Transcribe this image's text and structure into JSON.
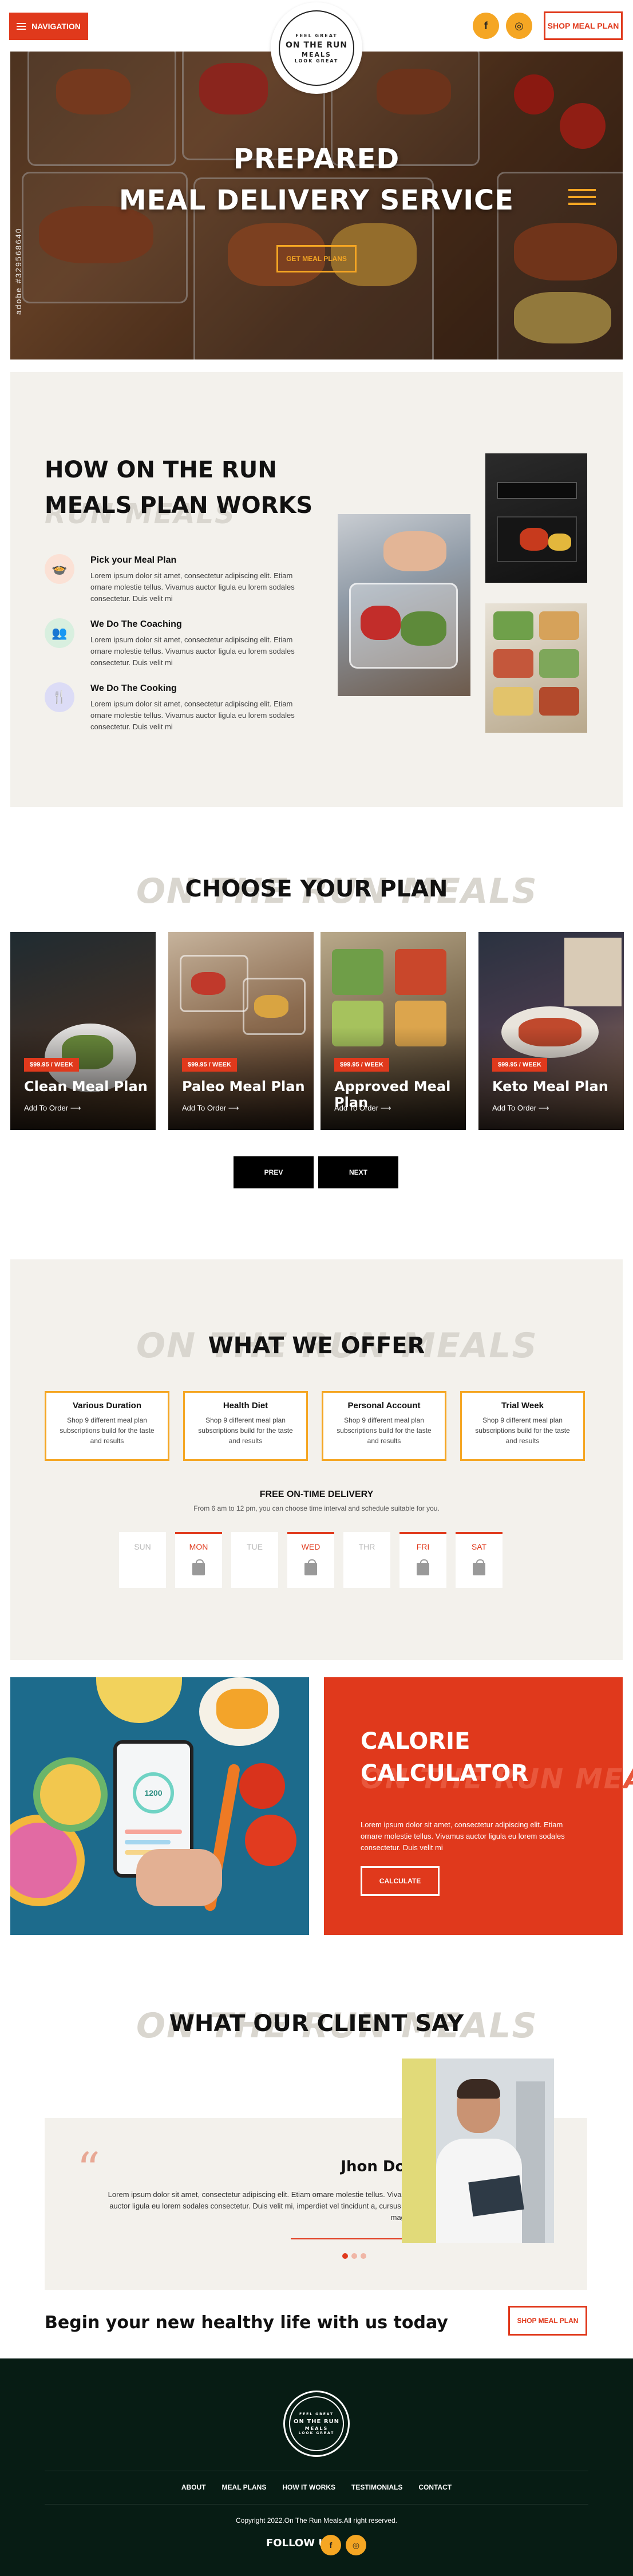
{
  "header": {
    "nav_label": "NAVIGATION",
    "logo": {
      "top": "FEEL GREAT",
      "main": "ON THE RUN",
      "sub": "MEALS",
      "bottom": "LOOK GREAT"
    },
    "social": [
      {
        "icon": "facebook-icon",
        "glyph": "f"
      },
      {
        "icon": "instagram-icon",
        "glyph": "◎"
      }
    ],
    "shop_label": "SHOP MEAL PLAN"
  },
  "hero": {
    "title_line1": "PREPARED",
    "title_line2": "MEAL DELIVERY SERVICE",
    "button": "GET MEAL PLANS",
    "watermark": "adobe #329568640"
  },
  "how": {
    "title": "HOW ON THE RUN MEALS PLAN WORKS",
    "ghost": "RUN MEALS",
    "steps": [
      {
        "icon": "meal-plan-icon",
        "title": "Pick your Meal Plan",
        "text": "Lorem ipsum dolor sit amet, consectetur adipiscing elit. Etiam ornare molestie tellus. Vivamus auctor ligula eu lorem sodales consectetur. Duis velit mi"
      },
      {
        "icon": "coaching-icon",
        "title": "We Do The Coaching",
        "text": "Lorem ipsum dolor sit amet, consectetur adipiscing elit. Etiam ornare molestie tellus. Vivamus auctor ligula eu lorem sodales consectetur. Duis velit mi"
      },
      {
        "icon": "cooking-icon",
        "title": "We Do The Cooking",
        "text": "Lorem ipsum dolor sit amet, consectetur adipiscing elit. Etiam ornare molestie tellus. Vivamus auctor ligula eu lorem sodales consectetur. Duis velit mi"
      }
    ]
  },
  "plans": {
    "title": "CHOOSE YOUR PLAN",
    "ghost": "ON THE RUN MEALS",
    "items": [
      {
        "price": "$99.95 / WEEK",
        "name": "Clean Meal Plan",
        "link": "Add To Order"
      },
      {
        "price": "$99.95 / WEEK",
        "name": "Paleo Meal Plan",
        "link": "Add To Order"
      },
      {
        "price": "$99.95 / WEEK",
        "name": "Approved Meal Plan",
        "link": "Add To Order"
      },
      {
        "price": "$99.95 / WEEK",
        "name": "Keto Meal Plan",
        "link": "Add To Order"
      }
    ],
    "prev": "PREV",
    "next": "NEXT"
  },
  "offer": {
    "title": "WHAT WE OFFER",
    "ghost": "ON THE RUN MEALS",
    "cards": [
      {
        "title": "Various Duration",
        "text": "Shop 9 different meal plan subscriptions build for the taste and results"
      },
      {
        "title": "Health Diet",
        "text": "Shop 9 different meal plan subscriptions build for the taste and results"
      },
      {
        "title": "Personal Account",
        "text": "Shop 9 different meal plan subscriptions build for the taste and results"
      },
      {
        "title": "Trial Week",
        "text": "Shop 9 different meal plan subscriptions build for the taste and results"
      }
    ],
    "delivery_title": "FREE ON-TIME DELIVERY",
    "delivery_sub": "From 6 am to 12 pm, you can choose time interval and schedule suitable for you.",
    "days": [
      {
        "label": "SUN",
        "active": false
      },
      {
        "label": "MON",
        "active": true
      },
      {
        "label": "TUE",
        "active": false
      },
      {
        "label": "WED",
        "active": true
      },
      {
        "label": "THR",
        "active": false
      },
      {
        "label": "FRI",
        "active": true
      },
      {
        "label": "SAT",
        "active": true
      }
    ]
  },
  "calorie": {
    "title": "CALORIE CALCULATOR",
    "ghost": "ON THE RUN MEALS",
    "text": "Lorem ipsum dolor sit amet, consectetur adipiscing elit. Etiam ornare molestie tellus. Vivamus auctor ligula eu lorem sodales consectetur. Duis velit mi",
    "button": "CALCULATE",
    "phone_reading": "1200"
  },
  "testimonial": {
    "title": "WHAT OUR CLIENT SAY",
    "ghost": "ON THE RUN MEALS",
    "name": "Jhon Doe",
    "text": "Lorem ipsum dolor sit amet, consectetur adipiscing elit. Etiam ornare molestie tellus. Vivamus auctor ligula eu lorem sodales consectetur. Duis velit mi, imperdiet vel tincidunt a, cursus non magna."
  },
  "cta": {
    "text": "Begin your new healthy life with us today",
    "button": "SHOP MEAL PLAN"
  },
  "footer": {
    "links": [
      "ABOUT",
      "MEAL PLANS",
      "HOW IT WORKS",
      "TESTIMONIALS",
      "CONTACT"
    ],
    "copyright": "Copyright 2022.On The Run Meals.All right reserved.",
    "follow": "FOLLOW US"
  },
  "colors": {
    "accent": "#e0391c",
    "secondary": "#f5a623",
    "footer_bg": "#071c14",
    "section_bg": "#f3f1ec"
  }
}
